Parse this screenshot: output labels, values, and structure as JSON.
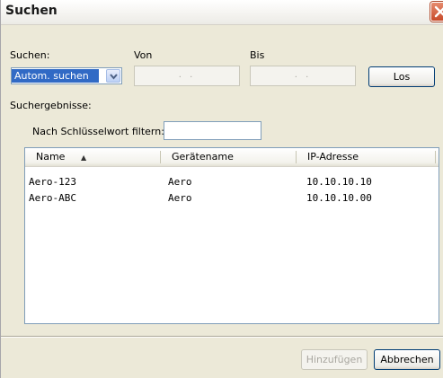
{
  "window": {
    "title": "Suchen",
    "close_label": "close"
  },
  "search": {
    "suchen_label": "Suchen:",
    "von_label": "Von",
    "bis_label": "Bis",
    "mode_value": "Autom. suchen",
    "von_value": "  .  .  ",
    "bis_value": "  .  .  ",
    "go_label": "Los"
  },
  "results": {
    "section_label": "Suchergebnisse:",
    "filter_label": "Nach Schlüsselwort filtern:",
    "filter_value": "",
    "columns": [
      "Name",
      "Gerätename",
      "IP-Adresse"
    ],
    "sort_indicator": "▲",
    "rows": [
      {
        "name": "Aero-123",
        "device": "Aero",
        "ip": "10.10.10.10"
      },
      {
        "name": "Aero-ABC",
        "device": "Aero",
        "ip": "10.10.10.00"
      }
    ]
  },
  "footer": {
    "add_label": "Hinzufügen",
    "cancel_label": "Abbrechen"
  },
  "colors": {
    "selection": "#316ac5",
    "close_red": "#c84b2a",
    "dialog_bg": "#ece9d8"
  }
}
